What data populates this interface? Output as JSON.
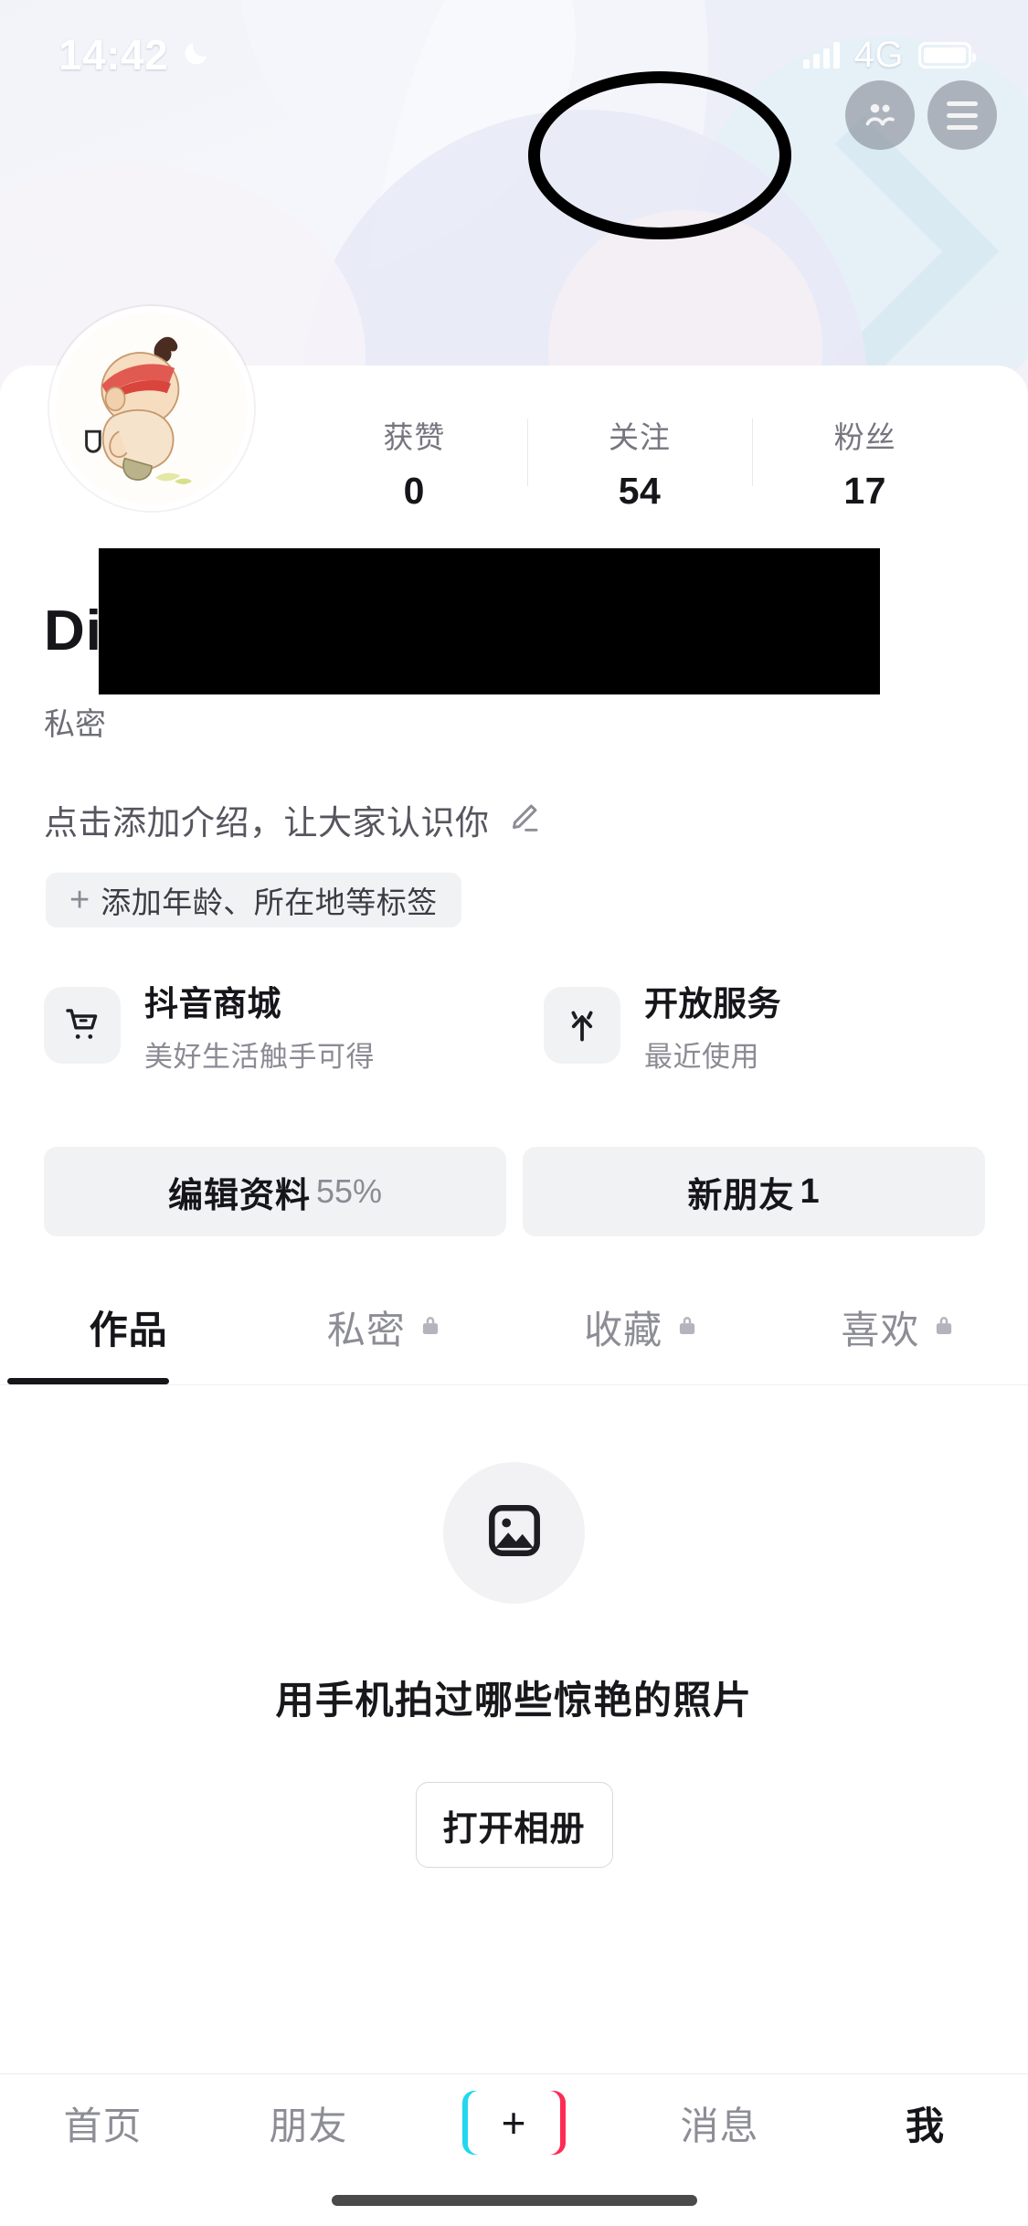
{
  "status_bar": {
    "time": "14:42",
    "dnd_icon": "moon-icon",
    "signal_icon": "signal-bars-icon",
    "network": "4G",
    "battery_icon": "battery-full-icon"
  },
  "header": {
    "add_friend_icon": "people-add-icon",
    "menu_icon": "hamburger-menu-icon",
    "annotation": "black-highlight-circle-on-menu"
  },
  "profile": {
    "avatar_icon": "cartoon-baby-avatar",
    "nickname": "Di",
    "sub_line": "私密",
    "redacted": true,
    "bio_placeholder": "点击添加介绍，让大家认识你",
    "bio_edit_icon": "pencil-icon",
    "tag_plus": "+",
    "tag_label": "添加年龄、所在地等标签"
  },
  "stats": [
    {
      "label": "获赞",
      "value": "0"
    },
    {
      "label": "关注",
      "value": "54"
    },
    {
      "label": "粉丝",
      "value": "17"
    }
  ],
  "services": [
    {
      "icon": "shopping-cart-icon",
      "title": "抖音商城",
      "subtitle": "美好生活触手可得"
    },
    {
      "icon": "douyin-star-icon",
      "title": "开放服务",
      "subtitle": "最近使用"
    }
  ],
  "actions": {
    "edit_profile_label": "编辑资料",
    "edit_profile_percent": "55%",
    "new_friends_label": "新朋友",
    "new_friends_count": "1"
  },
  "tabs": [
    {
      "label": "作品",
      "locked": false,
      "active": true
    },
    {
      "label": "私密",
      "locked": true,
      "active": false
    },
    {
      "label": "收藏",
      "locked": true,
      "active": false
    },
    {
      "label": "喜欢",
      "locked": true,
      "active": false
    }
  ],
  "empty_state": {
    "icon": "photo-image-icon",
    "text": "用手机拍过哪些惊艳的照片",
    "button_label": "打开相册"
  },
  "bottom_nav": [
    {
      "label": "首页",
      "active": false
    },
    {
      "label": "朋友",
      "active": false
    },
    {
      "label": "+",
      "active": false,
      "is_plus": true
    },
    {
      "label": "消息",
      "active": false
    },
    {
      "label": "我",
      "active": true
    }
  ],
  "colors": {
    "accent_pink": "#fe2c55",
    "accent_cyan": "#22d7ee",
    "text_primary": "#16161a",
    "text_muted": "#8d8d96",
    "chip_bg": "#f1f2f4"
  }
}
